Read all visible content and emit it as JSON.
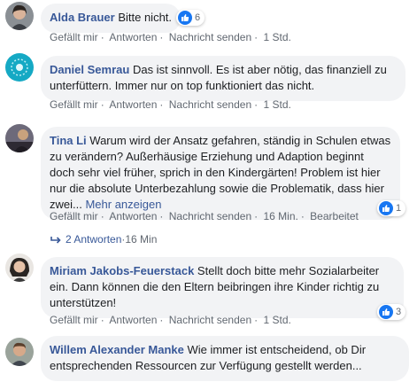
{
  "comments": [
    {
      "author": "Alda Brauer",
      "text": "Bitte nicht.",
      "likes": "6",
      "actions": {
        "like": "Gefällt mir",
        "reply": "Antworten",
        "message": "Nachricht senden",
        "time": "1 Std."
      }
    },
    {
      "author": "Daniel Semrau",
      "text": "Das ist sinnvoll. Es ist aber nötig, das finanziell zu unterfüttern. Immer nur on top funktioniert das nicht.",
      "actions": {
        "like": "Gefällt mir",
        "reply": "Antworten",
        "message": "Nachricht senden",
        "time": "1 Std."
      }
    },
    {
      "author": "Tina Li",
      "text": "Warum wird der Ansatz gefahren, ständig in Schulen etwas zu verändern? Außerhäusige Erziehung und Adaption beginnt doch sehr viel früher, sprich in den Kindergärten! Problem ist hier nur die absolute Unterbezahlung sowie die Problematik, dass hier zwei...",
      "more": "Mehr anzeigen",
      "likes": "1",
      "actions": {
        "like": "Gefällt mir",
        "reply": "Antworten",
        "message": "Nachricht senden",
        "time": "16 Min.",
        "edited": "Bearbeitet"
      },
      "replies": {
        "label": "2 Antworten",
        "time": "16 Min"
      }
    },
    {
      "author": "Miriam Jakobs-Feuerstack",
      "text": "Stellt doch bitte mehr Sozialarbeiter ein. Dann können die den Eltern beibringen ihre Kinder richtig zu unterstützen!",
      "likes": "3",
      "actions": {
        "like": "Gefällt mir",
        "reply": "Antworten",
        "message": "Nachricht senden",
        "time": "1 Std."
      }
    },
    {
      "author": "Willem Alexander Manke",
      "text": "Wie immer ist entscheidend, ob Dir entsprechenden Ressourcen zur Verfügung gestellt werden..."
    }
  ],
  "colors": {
    "link": "#385898",
    "bubble": "#f2f3f5",
    "like": "#1877f2",
    "meta": "#606770"
  },
  "icons": {
    "reaction": "like-icon",
    "reply": "reply-arrow-icon"
  }
}
